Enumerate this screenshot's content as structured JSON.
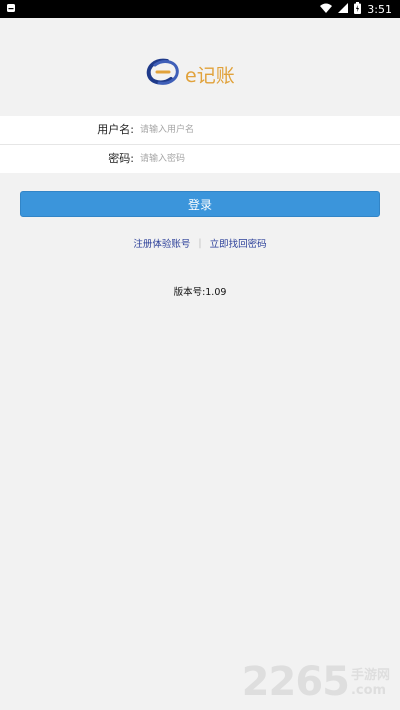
{
  "status_bar": {
    "time": "3:51",
    "icons": [
      "notification-icon",
      "wifi-icon",
      "signal-icon",
      "battery-icon"
    ]
  },
  "logo": {
    "text": "e记账",
    "colors": {
      "ring": "#1f3a8a",
      "accent": "#e1a23b"
    }
  },
  "form": {
    "username_label": "用户名:",
    "username_placeholder": "请输入用户名",
    "username_value": "",
    "password_label": "密码:",
    "password_placeholder": "请输入密码",
    "password_value": ""
  },
  "login_button": {
    "label": "登录",
    "color": "#3b95db"
  },
  "links": {
    "register": "注册体验账号",
    "recover": "立即找回密码",
    "color": "#2b3f99"
  },
  "version": "版本号:1.09",
  "watermark": {
    "number": "2265",
    "cn": "手游网",
    "com": ".com"
  }
}
